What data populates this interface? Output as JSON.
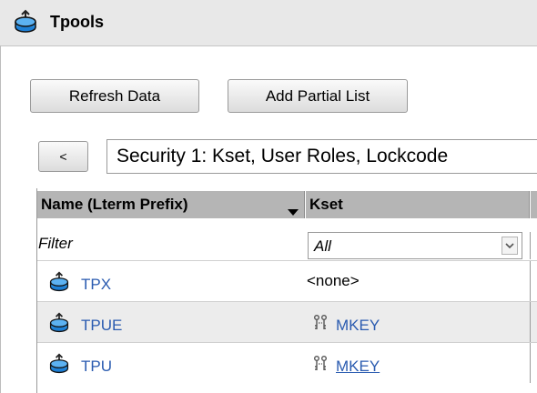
{
  "panel": {
    "title": "Tpools",
    "icon": "tpool-icon"
  },
  "toolbar": {
    "refresh_label": "Refresh Data",
    "add_list_label": "Add Partial List"
  },
  "nav": {
    "back_label": "<",
    "view_selector": "Security 1: Kset, User Roles, Lockcode"
  },
  "table": {
    "columns": [
      "Name (Lterm Prefix)",
      "Kset"
    ],
    "filter": {
      "name_placeholder": "Filter",
      "kset_value": "All"
    },
    "rows": [
      {
        "name": "TPX",
        "kset": "<none>"
      },
      {
        "name": "TPUE",
        "kset": "MKEY"
      },
      {
        "name": "TPU",
        "kset": "MKEY"
      }
    ]
  },
  "colors": {
    "link": "#2a5bb0",
    "header_bg": "#b5b5b5",
    "alt_row": "#ececec"
  }
}
